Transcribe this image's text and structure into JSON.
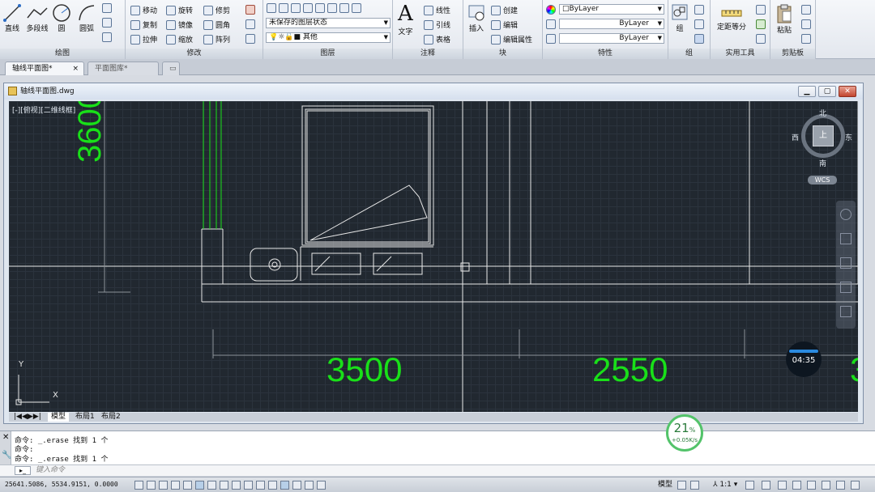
{
  "ribbon": {
    "draw": {
      "title": "绘图",
      "line": "直线",
      "polyline": "多段线",
      "circle": "圆",
      "arc": "圆弧"
    },
    "modify": {
      "title": "修改",
      "move": "移动",
      "rotate": "旋转",
      "trim": "修剪",
      "copy": "复制",
      "mirror": "镜像",
      "fillet": "圆角",
      "stretch": "拉伸",
      "scale": "缩放",
      "array": "阵列"
    },
    "layers": {
      "title": "图层",
      "layer_state": "未保存的图层状态",
      "current_layer": "其他"
    },
    "annotation": {
      "title": "注释",
      "text": "文字",
      "linear": "线性",
      "leader": "引线",
      "table": "表格"
    },
    "block": {
      "title": "块",
      "insert": "插入",
      "create": "创建",
      "edit": "编辑",
      "edit_attr": "编辑属性"
    },
    "properties": {
      "title": "特性",
      "color": "ByLayer",
      "linetype": "ByLayer",
      "lineweight": "ByLayer"
    },
    "groups": {
      "title": "组",
      "group": "组"
    },
    "utilities": {
      "title": "实用工具",
      "measure": "定距等分"
    },
    "clipboard": {
      "title": "剪贴板",
      "paste": "粘贴"
    }
  },
  "doc_tabs": [
    "轴线平面图*",
    "平面图库*"
  ],
  "window": {
    "title": "轴线平面图.dwg"
  },
  "viewport": {
    "label": "[-][俯视][二维线框]"
  },
  "viewcube": {
    "north": "北",
    "south": "南",
    "east": "东",
    "west": "西",
    "top": "上",
    "wcs": "WCS"
  },
  "dims": {
    "left_vertical": "3600",
    "d1": "3500",
    "d2": "2550",
    "d3": "3"
  },
  "ucs": {
    "x": "X",
    "y": "Y"
  },
  "layout_tabs": [
    "模型",
    "布局1",
    "布局2"
  ],
  "commands": [
    "命令: _.erase 找到 1 个",
    "命令:",
    "命令: _.erase 找到 1 个"
  ],
  "cmd_placeholder": "键入命令",
  "coords": "25641.5086, 5534.9151, 0.0000",
  "status": {
    "model": "模型",
    "scale": "1:1"
  },
  "gauge": {
    "percent": "21",
    "unit": "%",
    "rate": "+0.05K/s"
  },
  "clock": "04:35",
  "colors": {
    "accent_green": "#19e019",
    "canvas": "#212830",
    "line_white": "#e8e8e8"
  }
}
